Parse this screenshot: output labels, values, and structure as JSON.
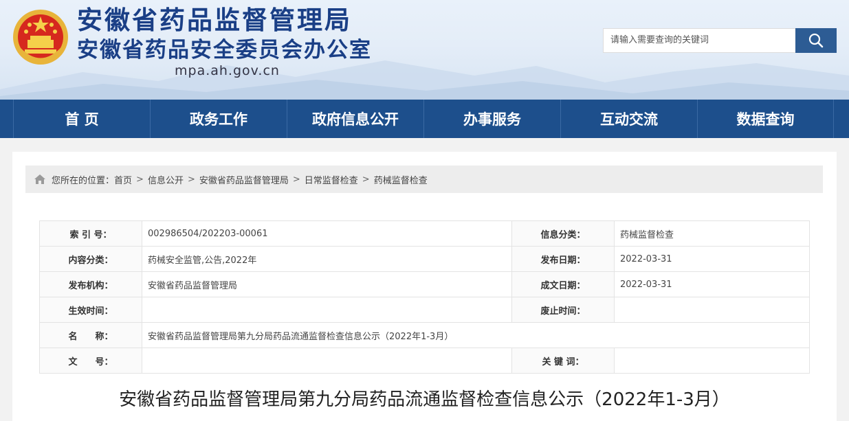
{
  "header": {
    "title_line1": "安徽省药品监督管理局",
    "title_line2": "安徽省药品安全委员会办公室",
    "domain": "mpa.ah.gov.cn",
    "emblem_icon": "national-emblem-icon",
    "search": {
      "placeholder": "请输入需要查询的关键词",
      "button_icon": "search-icon"
    }
  },
  "nav": {
    "items": [
      {
        "label": "首 页"
      },
      {
        "label": "政务工作"
      },
      {
        "label": "政府信息公开"
      },
      {
        "label": "办事服务"
      },
      {
        "label": "互动交流"
      },
      {
        "label": "数据查询"
      }
    ]
  },
  "breadcrumb": {
    "prefix": "您所在的位置：",
    "items": [
      "首页",
      "信息公开",
      "安徽省药品监督管理局",
      "日常监督检查",
      "药械监督检查"
    ],
    "separator": ">",
    "icon": "home-icon"
  },
  "info": {
    "index_label": "索 引 号：",
    "index_value": "002986504/202203-00061",
    "category_label": "信息分类：",
    "category_value": "药械监督检查",
    "content_label": "内容分类：",
    "content_value": "药械安全监管,公告,2022年",
    "pubdate_label": "发布日期：",
    "pubdate_value": "2022-03-31",
    "org_label": "发布机构：",
    "org_value": "安徽省药品监督管理局",
    "docdate_label": "成文日期：",
    "docdate_value": "2022-03-31",
    "effective_label": "生效时间：",
    "effective_value": "",
    "abolish_label": "废止时间：",
    "abolish_value": "",
    "name_label": "名　　称：",
    "name_value": "安徽省药品监督管理局第九分局药品流通监督检查信息公示（2022年1-3月）",
    "docno_label": "文　　号：",
    "docno_value": "",
    "keywords_label": "关 键 词：",
    "keywords_value": ""
  },
  "article": {
    "title": "安徽省药品监督管理局第九分局药品流通监督检查信息公示（2022年1-3月）"
  },
  "colors": {
    "nav_bg": "#1d4f8c",
    "title_blue": "#1a3f86",
    "search_btn": "#2d5c94"
  }
}
